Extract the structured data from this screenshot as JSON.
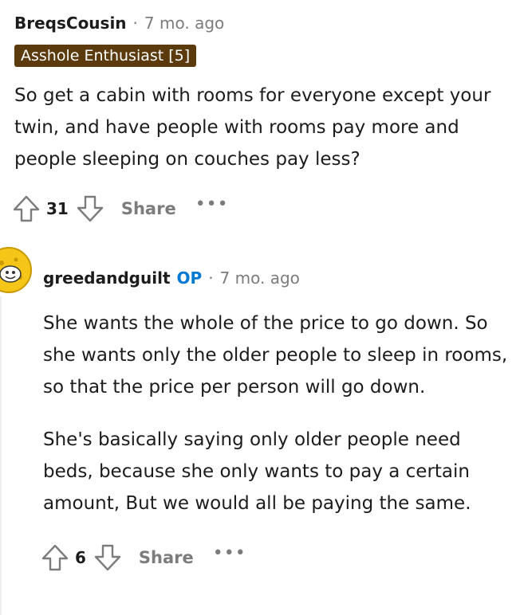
{
  "comment1": {
    "username": "BreqsCousin",
    "separator": "·",
    "time": "7 mo. ago",
    "flair": "Asshole Enthusiast [5]",
    "body": "So get a cabin with rooms for everyone except your twin, and have people with rooms pay more and people sleeping on couches pay less?",
    "score": "31",
    "share_label": "Share",
    "more_label": "•••"
  },
  "comment2": {
    "username": "greedandguilt",
    "op_label": "OP",
    "separator": "·",
    "time": "7 mo. ago",
    "paragraphs": [
      "She wants the whole of the price to go down. So she wants only the older people to sleep in rooms, so that the price per person will go down.",
      "She's basically saying only older people need beds, because she only wants to pay a certain amount, But we would all be paying the same."
    ],
    "score": "6",
    "share_label": "Share",
    "more_label": "•••"
  },
  "icons": {
    "upvote": "upvote-arrow-icon",
    "downvote": "downvote-arrow-icon",
    "avatar": "snoo-avatar"
  },
  "colors": {
    "flair_bg": "#5b3b0d",
    "op": "#0079d3",
    "meta_gray": "#7c7c7c",
    "avatar_yellow": "#f5c518"
  }
}
